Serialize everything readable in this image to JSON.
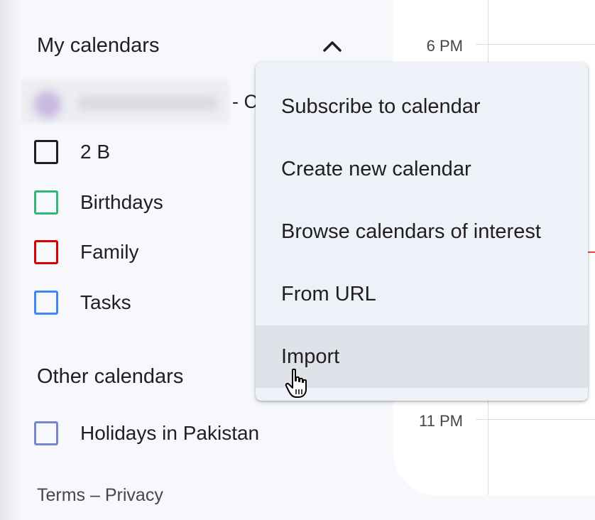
{
  "sidebar": {
    "my_calendars_title": "My calendars",
    "collapse_icon": "chevron-up-icon",
    "blurred_account_suffix": "- C",
    "my_calendars": [
      {
        "label": "2 B",
        "color": "#1f1f1f"
      },
      {
        "label": "Birthdays",
        "color": "#33b679"
      },
      {
        "label": "Family",
        "color": "#d50000"
      },
      {
        "label": "Tasks",
        "color": "#4285f4"
      }
    ],
    "other_calendars_title": "Other calendars",
    "other_calendars": [
      {
        "label": "Holidays in Pakistan",
        "color": "#7986cb"
      }
    ],
    "footer": {
      "terms": "Terms",
      "separator": "–",
      "privacy": "Privacy"
    }
  },
  "calendar": {
    "time_labels": [
      "6 PM",
      "11 PM"
    ],
    "current_time_color": "#ea4335"
  },
  "menu": {
    "items": [
      {
        "label": "Subscribe to calendar"
      },
      {
        "label": "Create new calendar"
      },
      {
        "label": "Browse calendars of interest"
      },
      {
        "label": "From URL"
      },
      {
        "label": "Import",
        "hovered": true
      }
    ]
  },
  "cursor_icon": "hand-pointer-icon"
}
